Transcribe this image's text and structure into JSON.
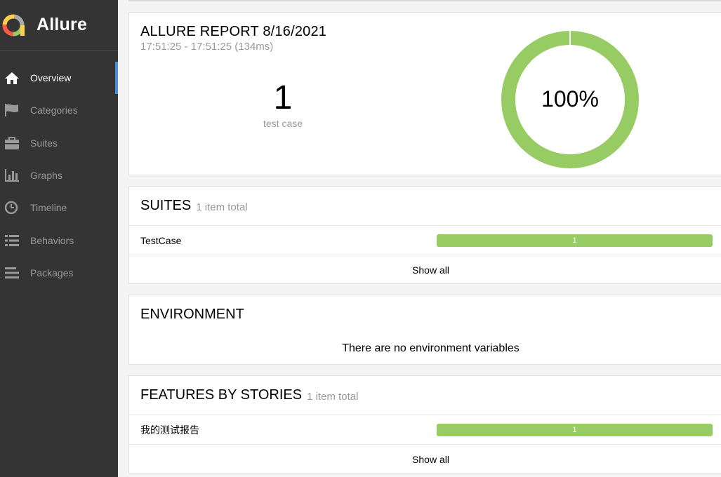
{
  "brand": {
    "name": "Allure"
  },
  "nav": [
    {
      "label": "Overview",
      "icon": "home-icon",
      "active": true
    },
    {
      "label": "Categories",
      "icon": "flag-icon"
    },
    {
      "label": "Suites",
      "icon": "briefcase-icon"
    },
    {
      "label": "Graphs",
      "icon": "bar-chart-icon"
    },
    {
      "label": "Timeline",
      "icon": "clock-icon"
    },
    {
      "label": "Behaviors",
      "icon": "list-icon"
    },
    {
      "label": "Packages",
      "icon": "align-left-icon"
    }
  ],
  "report": {
    "title": "ALLURE REPORT 8/16/2021",
    "time": "17:51:25 - 17:51:25 (134ms)",
    "count": "1",
    "count_label": "test case",
    "percent_label": "100%",
    "passed_fraction": 1.0,
    "passed_color": "#97cc64"
  },
  "suites": {
    "title": "SUITES",
    "total": "1 item total",
    "rows": [
      {
        "name": "TestCase",
        "count": "1"
      }
    ],
    "show_all": "Show all"
  },
  "environment": {
    "title": "ENVIRONMENT",
    "message": "There are no environment variables"
  },
  "features": {
    "title": "FEATURES BY STORIES",
    "total": "1 item total",
    "rows": [
      {
        "name": "我的测试报告",
        "count": "1"
      }
    ],
    "show_all": "Show all"
  }
}
